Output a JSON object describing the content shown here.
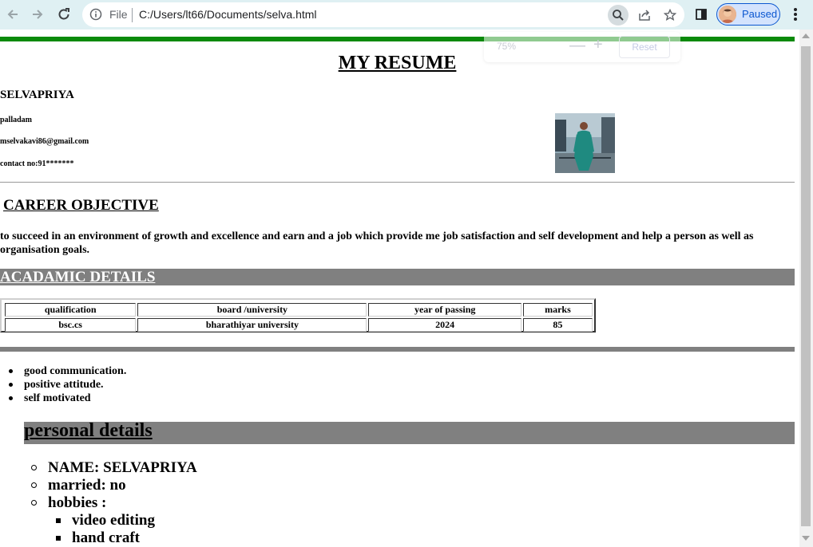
{
  "browser": {
    "file_label": "File",
    "url": "C:/Users/lt66/Documents/selva.html",
    "profile_status": "Paused",
    "zoom_popup": {
      "value": "75%",
      "minus": "—",
      "plus": "+",
      "reset": "Reset"
    }
  },
  "resume": {
    "title": "MY RESUME",
    "name": "SELVAPRIYA",
    "location": "palladam",
    "email": "mselvakavi86@gmail.com",
    "contact": "contact no:91*******",
    "career_heading": "CAREER OBJECTIVE",
    "career_text": "to succeed in an environment of growth and excellence and earn and a job which provide me job satisfaction and self development and help a person as well as organisation goals.",
    "academic_heading": "ACADAMIC DETAILS",
    "academic_table": {
      "headers": [
        "qualification",
        "board /university",
        "year of passing",
        "marks"
      ],
      "rows": [
        [
          "bsc.cs",
          "bharathiyar university",
          "2024",
          "85"
        ]
      ]
    },
    "skills": [
      "good communication.",
      "positive attitude.",
      "self motivated"
    ],
    "personal_heading": "personal details",
    "personal": {
      "name": "NAME: SELVAPRIYA",
      "married": "married: no",
      "hobbies_label": "hobbies :",
      "hobbies": [
        "video editing",
        "hand craft"
      ]
    }
  },
  "colors": {
    "green_bar": "#0a8a0a",
    "section_bar": "#808080"
  },
  "icons": [
    "back-arrow-icon",
    "forward-arrow-icon",
    "reload-icon",
    "info-icon",
    "zoom-icon",
    "share-icon",
    "star-icon",
    "sidepanel-icon",
    "kebab-menu-icon"
  ]
}
